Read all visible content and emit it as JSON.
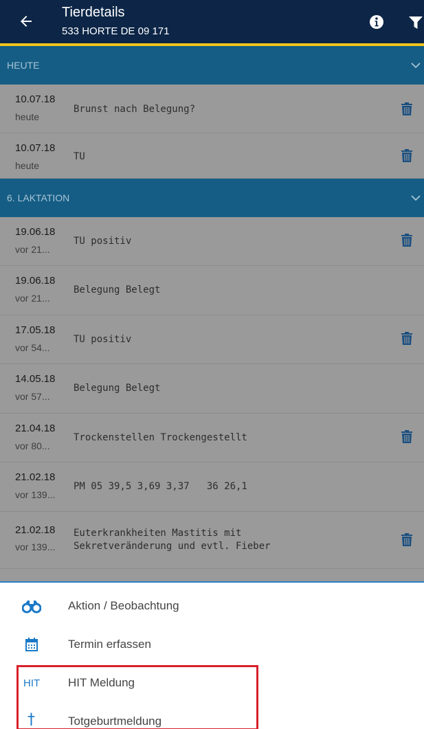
{
  "header": {
    "title": "Tierdetails",
    "subtitle": "533 HORTE DE 09 171",
    "icons": [
      "back-arrow-icon",
      "info-icon",
      "filter-icon"
    ]
  },
  "sections": [
    {
      "label": "HEUTE"
    },
    {
      "label": "6. LAKTATION"
    }
  ],
  "rows": [
    {
      "date": "10.07.18",
      "relative": "heute",
      "text": "Brunst nach Belegung?",
      "deletable": true
    },
    {
      "date": "10.07.18",
      "relative": "heute",
      "text": "TU",
      "deletable": true
    },
    {
      "date": "19.06.18",
      "relative": "vor 21...",
      "text": "TU positiv",
      "deletable": true
    },
    {
      "date": "19.06.18",
      "relative": "vor 21...",
      "text": "Belegung Belegt",
      "deletable": false
    },
    {
      "date": "17.05.18",
      "relative": "vor 54...",
      "text": "TU positiv",
      "deletable": true
    },
    {
      "date": "14.05.18",
      "relative": "vor 57...",
      "text": "Belegung Belegt",
      "deletable": false
    },
    {
      "date": "21.04.18",
      "relative": "vor 80...",
      "text": "Trockenstellen Trockengestellt",
      "deletable": true
    },
    {
      "date": "21.02.18",
      "relative": "vor 139...",
      "text": "PM 05 39,5 3,69 3,37   36 26,1",
      "deletable": false
    },
    {
      "date": "21.02.18",
      "relative": "vor 139...",
      "text": "Euterkrankheiten Mastitis mit\nSekretveränderung und evtl. Fieber",
      "deletable": true
    }
  ],
  "menu": [
    {
      "label": "Aktion / Beobachtung",
      "icon": "binoculars-icon"
    },
    {
      "label": "Termin erfassen",
      "icon": "calendar-icon"
    },
    {
      "label": "HIT Meldung",
      "icon": "hit-icon",
      "icon_text": "HIT"
    },
    {
      "label": "Totgeburtmeldung",
      "icon": "cross-icon",
      "icon_text": "†"
    }
  ],
  "colors": {
    "appbar": "#0d2647",
    "appbar_accent": "#f2c51c",
    "section": "#155d85",
    "overlay": "#9a9a9a",
    "trash": "#1b4f80",
    "menu_icon": "#1a79c8",
    "highlight": "#d7202a"
  }
}
